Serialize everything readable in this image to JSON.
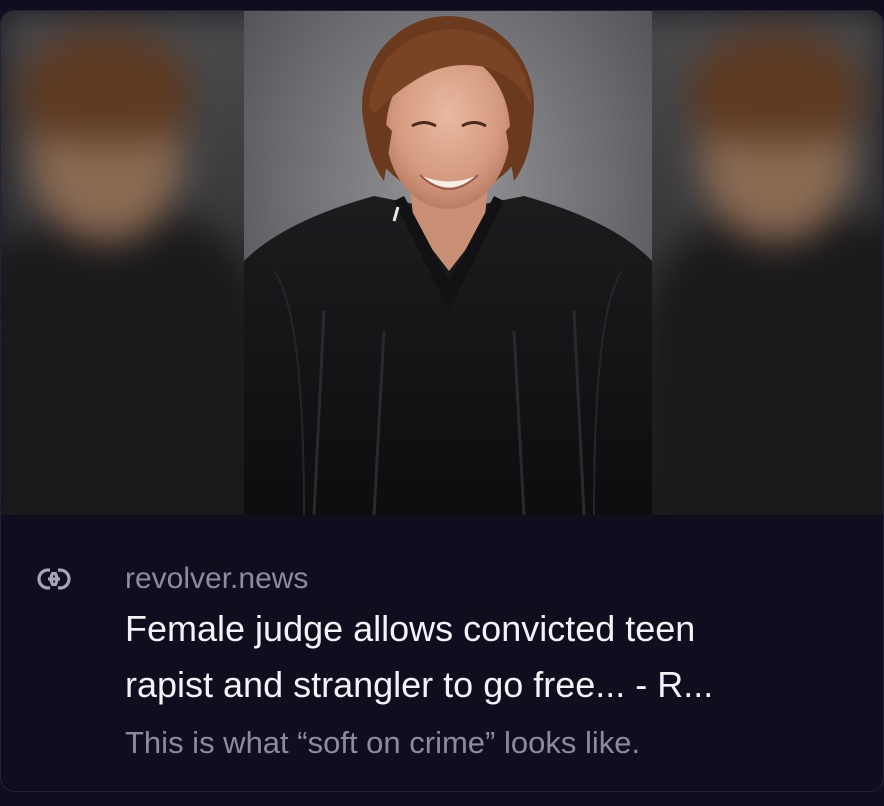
{
  "link_card": {
    "domain": "revolver.news",
    "title_line1": "Female judge allows convicted teen",
    "title_line2": "rapist and strangler to go free... - R...",
    "description": "This is what “soft on crime” looks like.",
    "icon": "link-icon"
  },
  "colors": {
    "background": "#0f0d1e",
    "title": "#f3f2f7",
    "muted": "#8c8aa0"
  }
}
